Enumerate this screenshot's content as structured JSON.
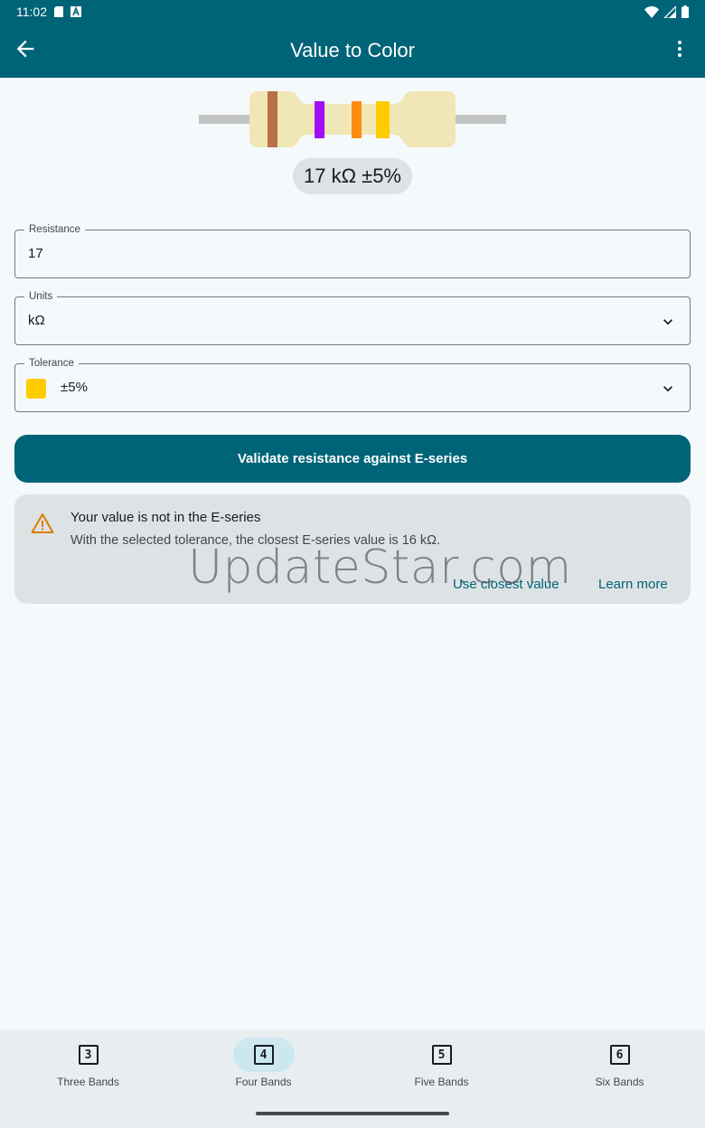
{
  "status_bar": {
    "time": "11:02"
  },
  "app_bar": {
    "title": "Value to Color",
    "back_icon": "arrow-back-icon",
    "more_icon": "more-vert-icon"
  },
  "resistor": {
    "body_color": "#f1e6b5",
    "lead_color": "#c4c4c4",
    "bands": [
      "#b87148",
      "#a10df5",
      "#ff8c0f",
      "#ffcc00"
    ]
  },
  "value_display": "17 kΩ ±5%",
  "resistance_field": {
    "label": "Resistance",
    "value": "17"
  },
  "units_field": {
    "label": "Units",
    "value": "kΩ"
  },
  "tolerance_field": {
    "label": "Tolerance",
    "value": "±5%",
    "swatch_color": "#ffcc00"
  },
  "validate_button": {
    "label": "Validate resistance against E-series"
  },
  "warning": {
    "icon": "warning-icon",
    "title": "Your value is not in the E-series",
    "message": "With the selected tolerance, the closest E-series value is 16 kΩ.",
    "use_closest_label": "Use closest value",
    "learn_more_label": "Learn more"
  },
  "watermark": "UpdateStar.com",
  "bottom_nav": {
    "items": [
      {
        "number": "3",
        "label": "Three Bands",
        "active": false
      },
      {
        "number": "4",
        "label": "Four Bands",
        "active": true
      },
      {
        "number": "5",
        "label": "Five Bands",
        "active": false
      },
      {
        "number": "6",
        "label": "Six Bands",
        "active": false
      }
    ]
  },
  "colors": {
    "primary": "#006478",
    "surface": "#f4f9fc",
    "warning": "#e07a00"
  }
}
